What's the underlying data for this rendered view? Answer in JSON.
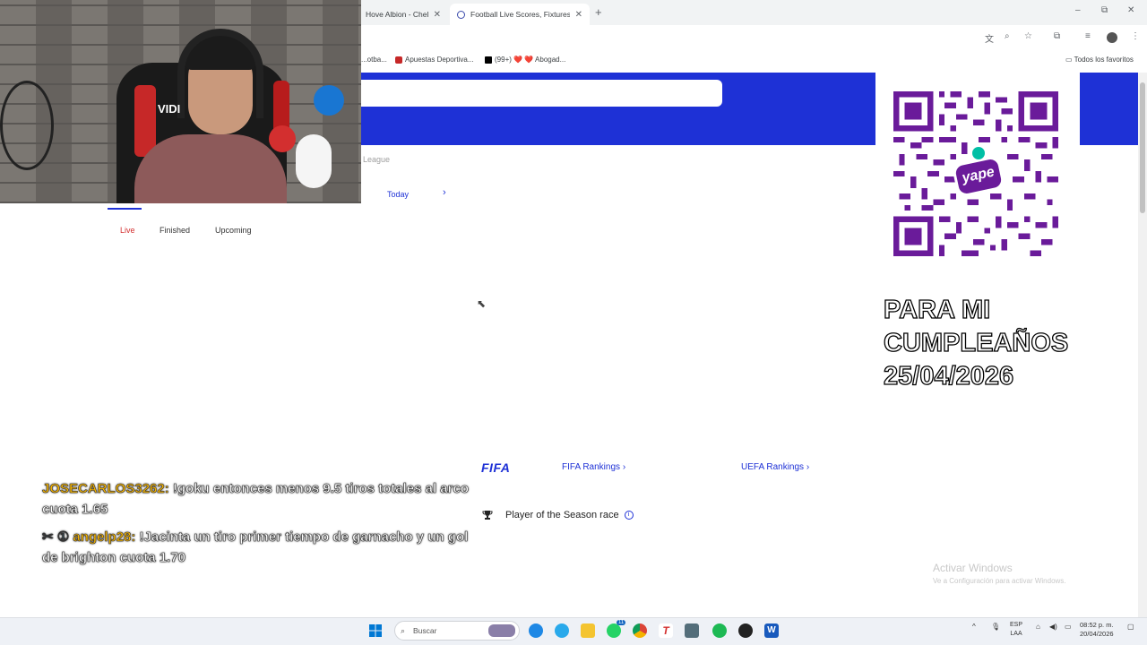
{
  "browser": {
    "tabs": [
      {
        "label": "Hove Albion - Chel..."
      },
      {
        "label": "Football Live Scores, Fixtures &..."
      }
    ],
    "new_tab": "+",
    "window_controls": [
      "–",
      "⧉",
      "✕"
    ],
    "bookmarks": {
      "item1": "...otba...",
      "item2": "Apuestas Deportiva...",
      "item3": "(99+) ❤️ ❤️ Abogad...",
      "all_favorites": "Todos los favoritos"
    }
  },
  "page": {
    "league_label": "League",
    "today_label": "Today",
    "today_arrow": "›",
    "match_tabs": {
      "live": "Live",
      "finished": "Finished",
      "upcoming": "Upcoming"
    },
    "fifa_logo": "FIFA",
    "fifa_rankings": "FIFA Rankings",
    "uefa_rankings": "UEFA Rankings",
    "player_of_season": "Player of the Season race"
  },
  "webcam": {
    "chair_text": "VIDI"
  },
  "overlay": {
    "qr_brand": "yape",
    "birthday_lines": [
      "PARA MI",
      "CUMPLEAÑOS",
      "25/04/2026"
    ]
  },
  "chat": [
    {
      "user": "JOSECARLOS3262:",
      "text": " !goku entonces menos 9.5 tiros totales al arco cuota 1.65"
    },
    {
      "badges": "✂ ①",
      "user": "angelp28:",
      "text": " !Jacinta un tiro primer tiempo de garnacho y un gol de brighton cuota 1.70"
    }
  ],
  "windows": {
    "activate_title": "Activar Windows",
    "activate_sub": "Ve a Configuración para activar Windows."
  },
  "taskbar": {
    "search_placeholder": "Buscar",
    "lang_top": "ESP",
    "lang_bottom": "LAA",
    "time": "08:52 p. m.",
    "date": "20/04/2026",
    "whatsapp_badge": "11"
  },
  "colors": {
    "brand_blue": "#1e31d6",
    "live_red": "#d32f2f",
    "chat_user": "#f6b400"
  }
}
